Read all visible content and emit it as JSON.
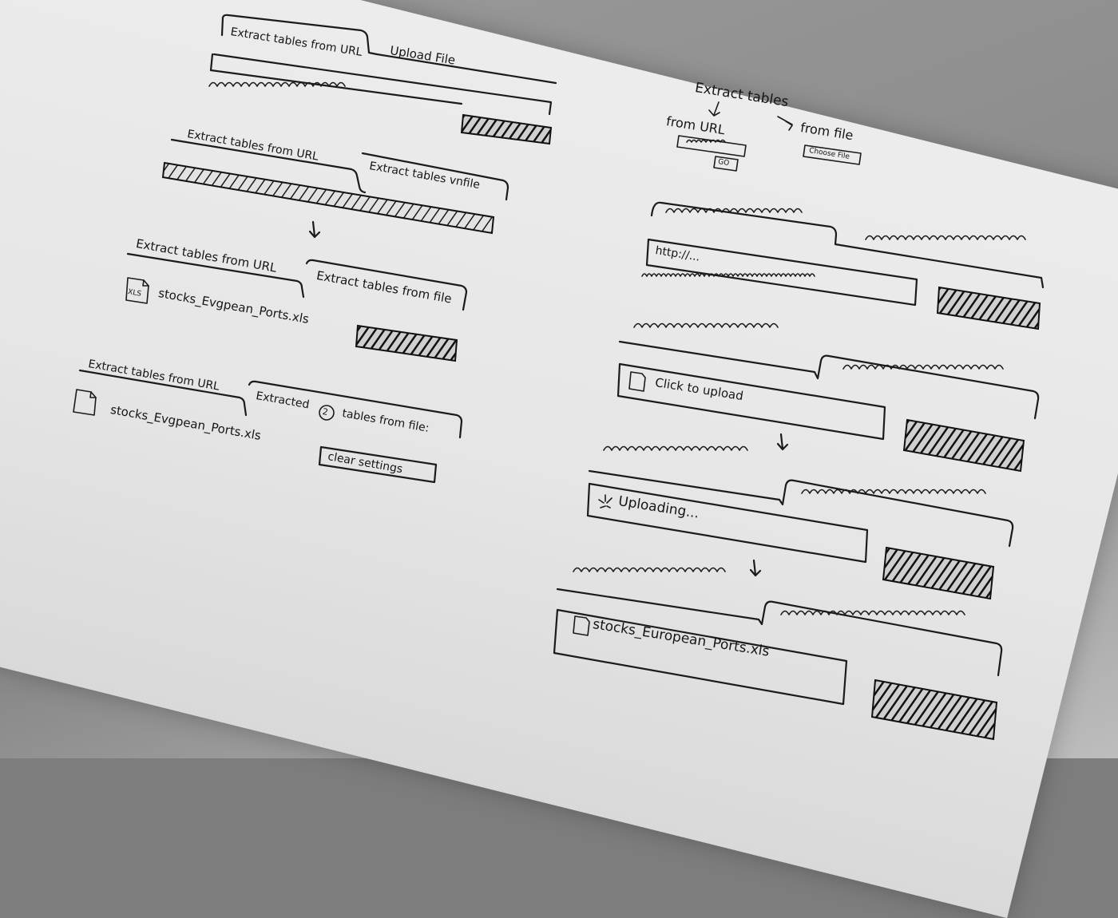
{
  "left_column": {
    "sketch1": {
      "tab_active": "Extract tables from URL",
      "tab_inactive": "Upload File"
    },
    "sketch2": {
      "tab_inactive": "Extract tables from URL",
      "tab_active": "Extract tables vnfile"
    },
    "sketch3": {
      "tab_inactive": "Extract tables from URL",
      "tab_active": "Extract tables from file",
      "file_badge": "XLS",
      "file_name": "stocks_Evgpean_Ports.xls"
    },
    "sketch4": {
      "tab_inactive": "Extract tables from URL",
      "tab_active_prefix": "Extracted",
      "tab_count": "2",
      "tab_active_suffix": "tables from file:",
      "file_name": "stocks_Evgpean_Ports.xls",
      "clear_button": "clear settings"
    }
  },
  "right_column": {
    "overview": {
      "title": "Extract tables",
      "from_url": "from URL",
      "from_file": "from file",
      "go_button": "GO",
      "choose_file_button": "Choose File"
    },
    "url_input_value": "http://...",
    "upload_placeholder": "Click to upload",
    "uploading_status": "Uploading...",
    "uploaded_file": "stocks_European_Ports.xls"
  },
  "icons": [
    "arrow-down-icon",
    "file-icon",
    "xls-file-icon",
    "spinner-icon",
    "numbered-circle-icon"
  ],
  "colors": {
    "ink": "#1b1b1b",
    "paper": "#e8e8e8",
    "table": "#8f8f8f"
  }
}
